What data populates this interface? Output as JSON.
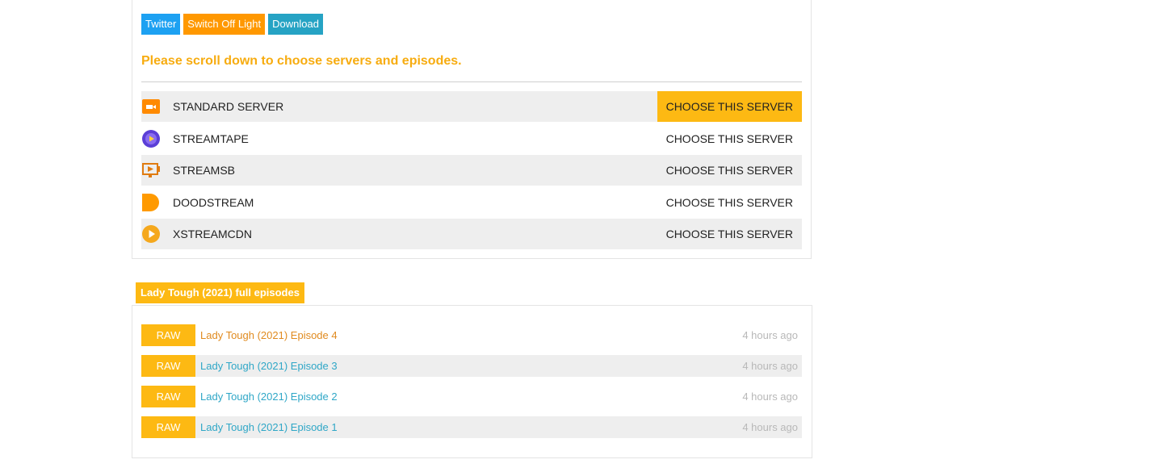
{
  "share": {
    "twitter": "Twitter",
    "switch_light": "Switch Off Light",
    "download": "Download"
  },
  "notice": "Please scroll down to choose servers and episodes.",
  "servers": [
    {
      "name": "STANDARD SERVER",
      "choose": "CHOOSE THIS SERVER",
      "icon": "video-camera-icon",
      "active": true
    },
    {
      "name": "STREAMTAPE",
      "choose": "CHOOSE THIS SERVER",
      "icon": "play-circle-icon",
      "active": false
    },
    {
      "name": "STREAMSB",
      "choose": "CHOOSE THIS SERVER",
      "icon": "screen-play-icon",
      "active": false
    },
    {
      "name": "DOODSTREAM",
      "choose": "CHOOSE THIS SERVER",
      "icon": "dood-d-icon",
      "active": false
    },
    {
      "name": "XSTREAMCDN",
      "choose": "CHOOSE THIS SERVER",
      "icon": "play-circle-icon",
      "active": false
    }
  ],
  "episodes_tab": "Lady Tough (2021) full episodes",
  "episodes": [
    {
      "tag": "RAW",
      "title": "Lady Tough (2021) Episode 4",
      "time": "4 hours ago"
    },
    {
      "tag": "RAW",
      "title": "Lady Tough (2021) Episode 3",
      "time": "4 hours ago"
    },
    {
      "tag": "RAW",
      "title": "Lady Tough (2021) Episode 2",
      "time": "4 hours ago"
    },
    {
      "tag": "RAW",
      "title": "Lady Tough (2021) Episode 1",
      "time": "4 hours ago"
    }
  ],
  "colors": {
    "accent": "#fdb913",
    "twitter": "#1da1f2",
    "light": "#ff9800",
    "download": "#26a3c4",
    "link": "#2fa7c7",
    "visited": "#e08a1e"
  }
}
